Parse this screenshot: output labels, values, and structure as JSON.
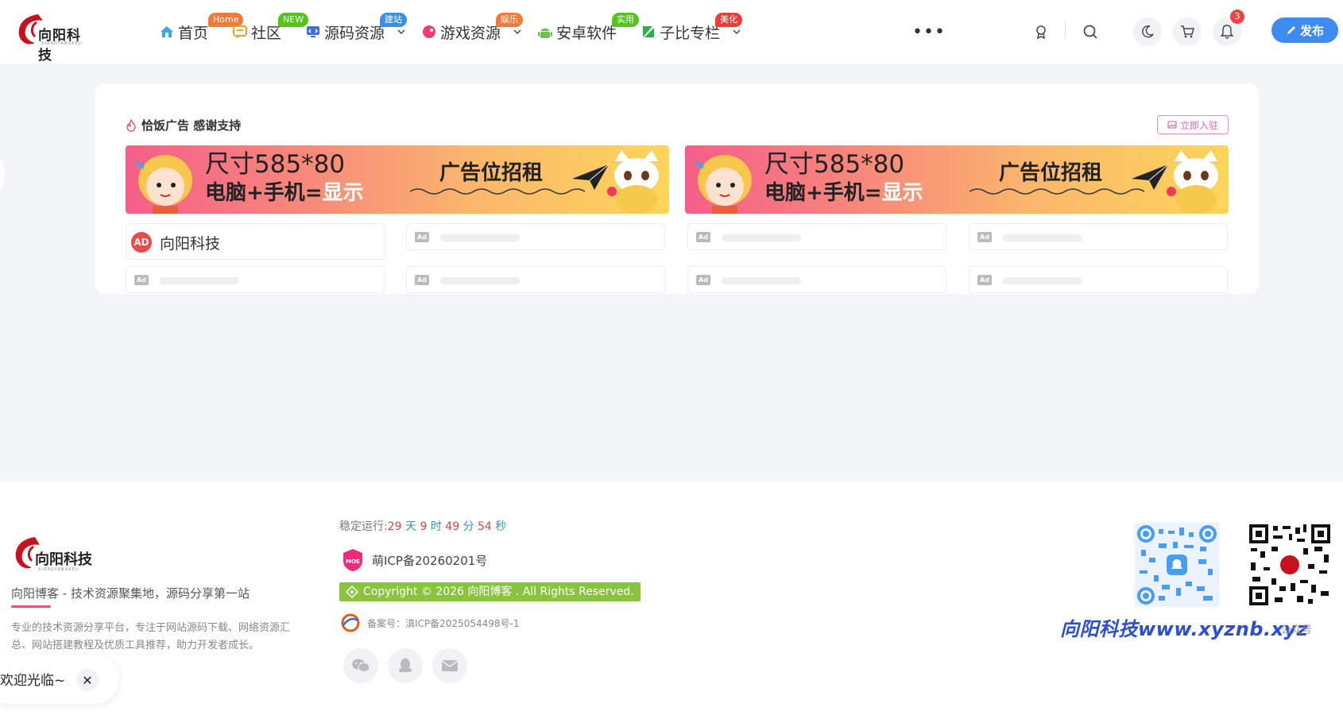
{
  "logo": {
    "brand": "向阳科技",
    "sub": "XIANGYANGKEJI"
  },
  "nav": [
    {
      "label": "首页",
      "badge": "Home",
      "badge_color": "#f07a3a",
      "icon": "home-icon",
      "icon_color": "#3aa8e8",
      "caret": false
    },
    {
      "label": "社区",
      "badge": "NEW",
      "badge_color": "#52c41a",
      "icon": "chat-icon",
      "icon_color": "#f0a020",
      "caret": false
    },
    {
      "label": "源码资源",
      "badge": "建站",
      "badge_color": "#3a8fe8",
      "icon": "monitor-icon",
      "icon_color": "#3a6fe8",
      "caret": true
    },
    {
      "label": "游戏资源",
      "badge": "娱乐",
      "badge_color": "#f07a3a",
      "icon": "game-icon",
      "icon_color": "#ef3a7a",
      "caret": true
    },
    {
      "label": "安卓软件",
      "badge": "实用",
      "badge_color": "#52c41a",
      "icon": "android-icon",
      "icon_color": "#6cc04a",
      "caret": false
    },
    {
      "label": "子比专栏",
      "badge": "美化",
      "badge_color": "#ef3a3a",
      "icon": "edit-icon",
      "icon_color": "#2bb04a",
      "caret": true
    }
  ],
  "header": {
    "more": "•••",
    "notifications": "3",
    "publish_label": "发布"
  },
  "ads": {
    "title": "恰饭广告 感谢支持",
    "join_label": "立即入驻",
    "banner": {
      "size": "尺寸585*80",
      "sub_a": "电脑+手机=",
      "sub_b": "显示",
      "right": "广告位招租"
    },
    "text_ad": {
      "icon": "AD",
      "name": "向阳科技"
    },
    "ad_tag": "Ad"
  },
  "footer": {
    "logo_brand": "向阳科技",
    "logo_sub": "XIANGYANGKEJI",
    "slogan": "向阳博客 - 技术资源聚集地，源码分享第一站",
    "desc": "专业的技术资源分享平台，专注于网站源码下载、网络资源汇总、网站搭建教程及优质工具推荐，助力开发者成长。",
    "uptime": {
      "prefix": "稳定运行:",
      "days": "29",
      "d": "天",
      "hours": "9",
      "h": "时",
      "minutes": "49",
      "m": "分",
      "seconds": "54",
      "s": "秒"
    },
    "icp": "萌ICP备20260201号",
    "moe_badge": "MOE",
    "copyright": "Copyright © 2026 向阳博客 . All Rights Reserved.",
    "beian": "备案号：滇ICP备2025054498号-1",
    "qr_label": "公众号",
    "watermark": "向阳科技www.xyznb.xyz"
  },
  "welcome": {
    "text": "欢迎光临~",
    "close": "✕"
  }
}
